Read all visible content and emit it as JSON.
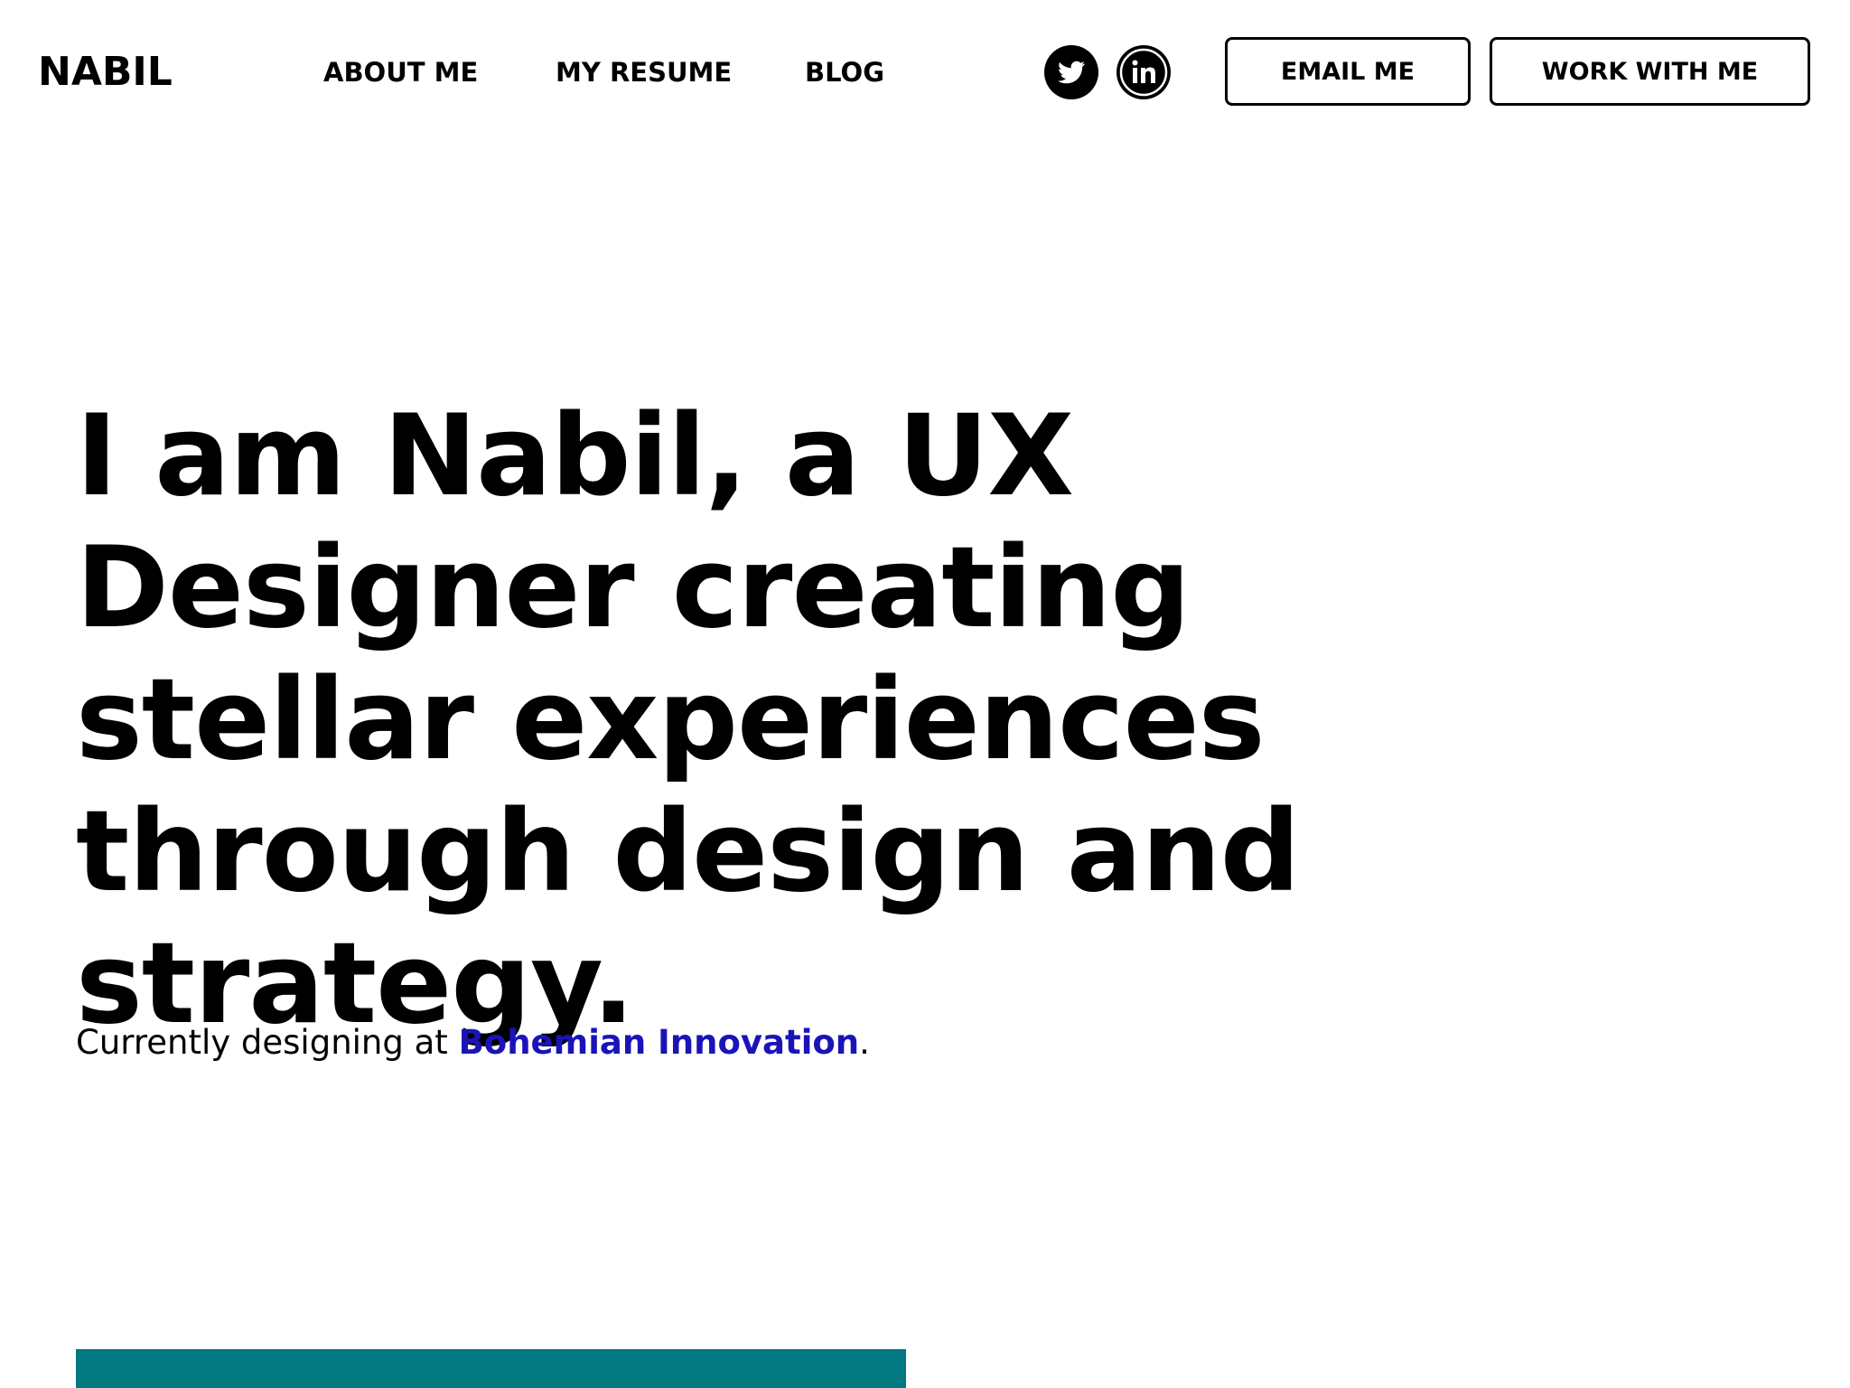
{
  "header": {
    "logo": "NABIL",
    "nav": [
      {
        "label": "ABOUT ME"
      },
      {
        "label": "MY RESUME"
      },
      {
        "label": "BLOG"
      }
    ],
    "social": [
      {
        "icon": "twitter-icon"
      },
      {
        "icon": "linkedin-icon"
      }
    ],
    "buttons": {
      "email_label": "EMAIL ME",
      "work_label": "WORK WITH ME"
    }
  },
  "hero": {
    "headline": "I am Nabil, a UX Designer creating stellar experiences through design and strategy.",
    "current_prefix": "Currently designing at ",
    "company_link": "Bohemian Innovation",
    "current_suffix": "."
  },
  "colors": {
    "text": "#000000",
    "link": "#1a14b8",
    "accent_block": "#027880",
    "background": "#ffffff"
  }
}
